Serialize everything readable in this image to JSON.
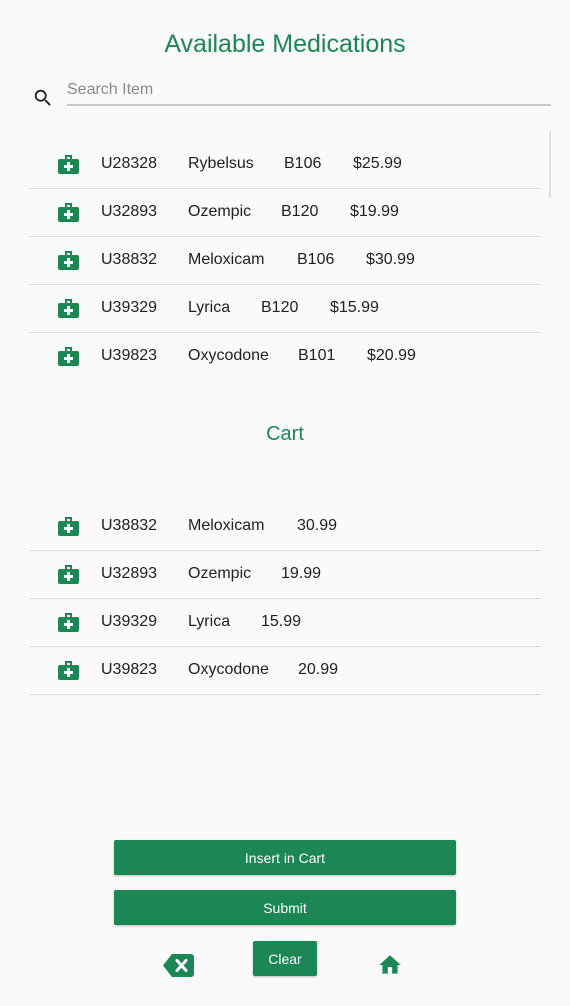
{
  "header": {
    "title": "Available Medications"
  },
  "search": {
    "placeholder": "Search Item",
    "value": "",
    "icon": "search-icon"
  },
  "inventory": [
    {
      "icon": "medical-kit-icon",
      "id": "U28328",
      "name": "Rybelsus",
      "bin": "B106",
      "price": "$25.99"
    },
    {
      "icon": "medical-kit-icon",
      "id": "U32893",
      "name": "Ozempic",
      "bin": "B120",
      "price": "$19.99"
    },
    {
      "icon": "medical-kit-icon",
      "id": "U38832",
      "name": "Meloxicam",
      "bin": "B106",
      "price": "$30.99"
    },
    {
      "icon": "medical-kit-icon",
      "id": "U39329",
      "name": "Lyrica",
      "bin": "B120",
      "price": "$15.99"
    },
    {
      "icon": "medical-kit-icon",
      "id": "U39823",
      "name": "Oxycodone",
      "bin": "B101",
      "price": "$20.99"
    }
  ],
  "cart": {
    "title": "Cart",
    "items": [
      {
        "icon": "medical-kit-icon",
        "id": "U38832",
        "name": "Meloxicam",
        "price": "30.99"
      },
      {
        "icon": "medical-kit-icon",
        "id": "U32893",
        "name": "Ozempic",
        "price": "19.99"
      },
      {
        "icon": "medical-kit-icon",
        "id": "U39329",
        "name": "Lyrica",
        "price": "15.99"
      },
      {
        "icon": "medical-kit-icon",
        "id": "U39823",
        "name": "Oxycodone",
        "price": "20.99"
      }
    ]
  },
  "actions": {
    "insert_label": "Insert in Cart",
    "submit_label": "Submit",
    "clear_label": "Clear",
    "backspace_icon": "backspace-icon",
    "home_icon": "home-icon"
  },
  "colors": {
    "accent": "#1a8754",
    "divider": "#dcdcdc",
    "background": "#fafafa"
  }
}
